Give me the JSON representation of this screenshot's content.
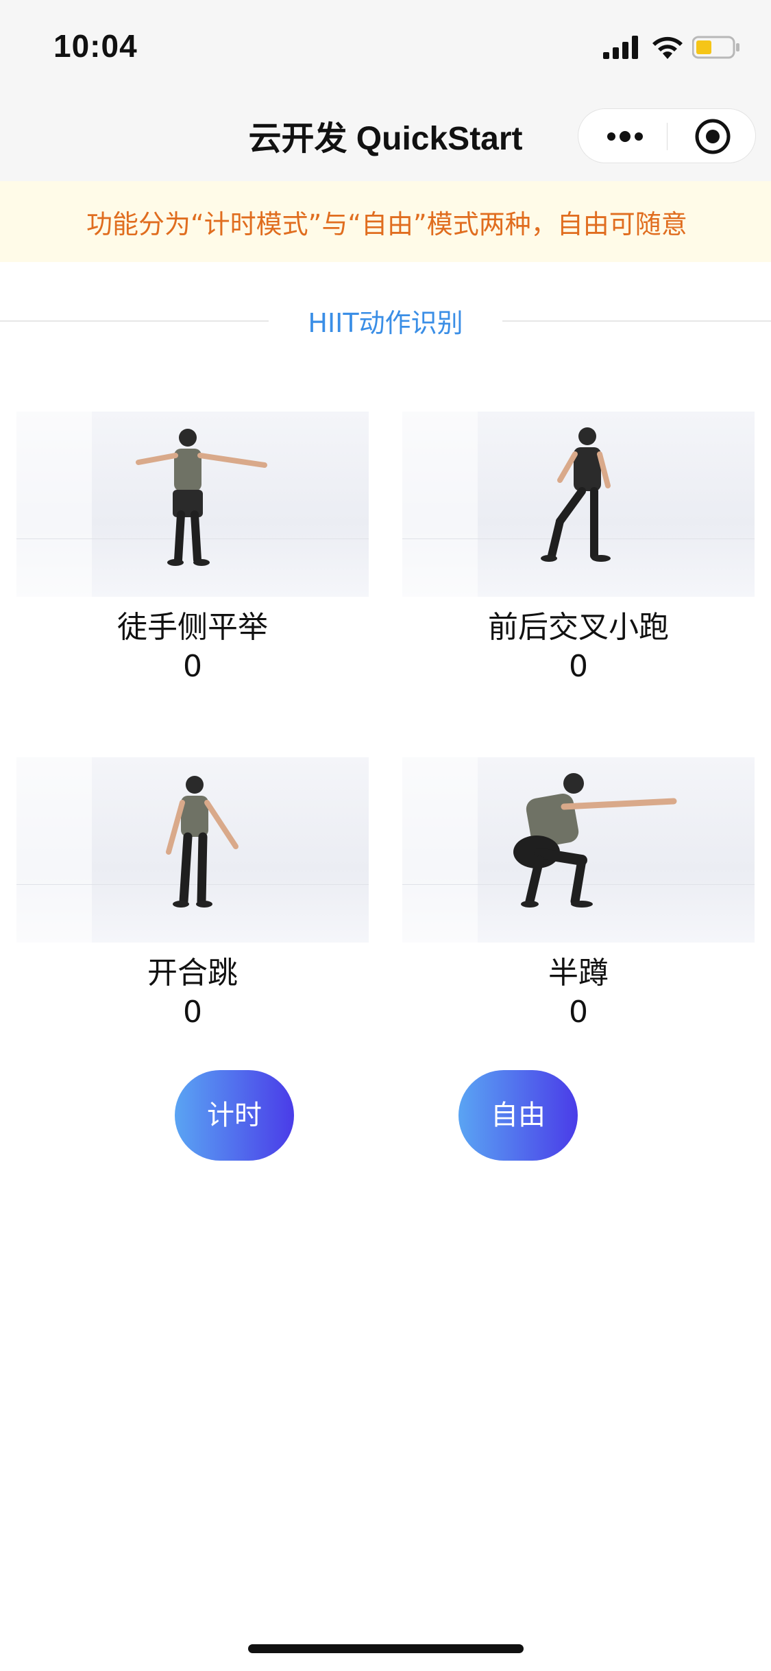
{
  "status_bar": {
    "time": "10:04"
  },
  "nav": {
    "title": "云开发 QuickStart"
  },
  "notice": {
    "text": "功能分为“计时模式”与“自由”模式两种，自由可随意"
  },
  "section": {
    "title": "HIIT动作识别"
  },
  "exercises": [
    {
      "name": "徒手侧平举",
      "count": "0"
    },
    {
      "name": "前后交叉小跑",
      "count": "0"
    },
    {
      "name": "开合跳",
      "count": "0"
    },
    {
      "name": "半蹲",
      "count": "0"
    }
  ],
  "buttons": {
    "timer_label": "计时",
    "free_label": "自由"
  },
  "colors": {
    "accent_blue": "#3a8ee6",
    "notice_text": "#e06d1f",
    "notice_bg": "#fffbe8",
    "button_start": "#5aa4f3",
    "button_end": "#4a3ce8"
  }
}
